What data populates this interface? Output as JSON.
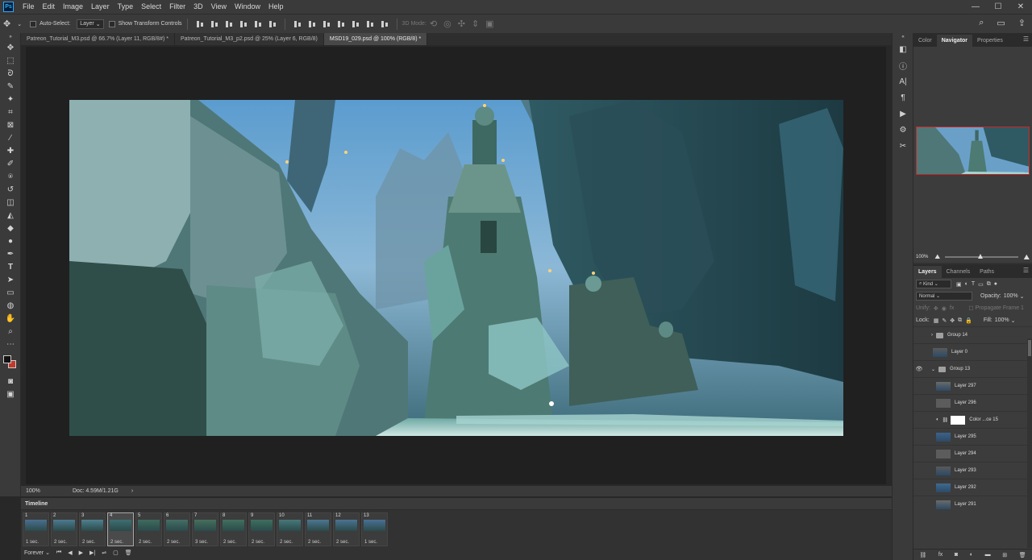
{
  "app": {
    "logo": "Ps"
  },
  "menu": [
    "File",
    "Edit",
    "Image",
    "Layer",
    "Type",
    "Select",
    "Filter",
    "3D",
    "View",
    "Window",
    "Help"
  ],
  "window_controls": [
    "minimize-icon",
    "maximize-icon",
    "close-icon"
  ],
  "options": {
    "auto_select_label": "Auto-Select:",
    "auto_select_value": "Layer",
    "transform_label": "Show Transform Controls",
    "mode_3d_label": "3D Mode:"
  },
  "tabs": [
    {
      "label": "Patreon_Tutorial_M3.psd @ 66.7% (Layer 11, RGB/8#) *",
      "active": false
    },
    {
      "label": "Patreon_Tutorial_M3_p2.psd @ 25% (Layer 6, RGB/8)",
      "active": false
    },
    {
      "label": "MSD19_029.psd @ 100% (RGB/8) *",
      "active": true
    }
  ],
  "status": {
    "zoom": "100%",
    "doc": "Doc: 4.59M/1.21G"
  },
  "timeline": {
    "title": "Timeline",
    "frames": [
      {
        "num": "1",
        "time": "1 sec."
      },
      {
        "num": "2",
        "time": "2 sec."
      },
      {
        "num": "3",
        "time": "2 sec."
      },
      {
        "num": "4",
        "time": "2 sec."
      },
      {
        "num": "5",
        "time": "2 sec."
      },
      {
        "num": "6",
        "time": "2 sec."
      },
      {
        "num": "7",
        "time": "3 sec."
      },
      {
        "num": "8",
        "time": "2 sec."
      },
      {
        "num": "9",
        "time": "2 sec."
      },
      {
        "num": "10",
        "time": "2 sec."
      },
      {
        "num": "11",
        "time": "2 sec."
      },
      {
        "num": "12",
        "time": "2 sec."
      },
      {
        "num": "13",
        "time": "1 sec."
      }
    ],
    "selected_frame": "4",
    "loop": "Forever"
  },
  "panels": {
    "top_tabs": [
      "Color",
      "Navigator",
      "Properties"
    ],
    "top_active": "Navigator",
    "nav_zoom": "100%",
    "layer_tabs": [
      "Layers",
      "Channels",
      "Paths"
    ],
    "layer_active": "Layers",
    "filter_kind": "Kind",
    "blend_mode": "Normal",
    "opacity_label": "Opacity:",
    "opacity_value": "100%",
    "unify_label": "Unify:",
    "propagate_label": "Propagate Frame 1",
    "lock_label": "Lock:",
    "fill_label": "Fill:",
    "fill_value": "100%"
  },
  "layers": [
    {
      "name": "Group 14",
      "type": "group",
      "visible": false,
      "indent": 0
    },
    {
      "name": "Layer 0",
      "type": "layer",
      "visible": false,
      "indent": 0
    },
    {
      "name": "Group 13",
      "type": "group",
      "visible": true,
      "indent": 0
    },
    {
      "name": "Layer 297",
      "type": "layer",
      "visible": false,
      "indent": 1
    },
    {
      "name": "Layer 296",
      "type": "layer",
      "visible": false,
      "indent": 1
    },
    {
      "name": "Color ...ce 15",
      "type": "adjustment",
      "visible": false,
      "indent": 1
    },
    {
      "name": "Layer 295",
      "type": "layer",
      "visible": false,
      "indent": 1
    },
    {
      "name": "Layer 294",
      "type": "layer",
      "visible": false,
      "indent": 1
    },
    {
      "name": "Layer 293",
      "type": "layer",
      "visible": false,
      "indent": 1
    },
    {
      "name": "Layer 292",
      "type": "layer",
      "visible": false,
      "indent": 1
    },
    {
      "name": "Layer 291",
      "type": "layer",
      "visible": false,
      "indent": 1
    }
  ],
  "colors": {
    "foreground": "#111111",
    "background": "#c0392b",
    "accent": "#31a8ff"
  }
}
